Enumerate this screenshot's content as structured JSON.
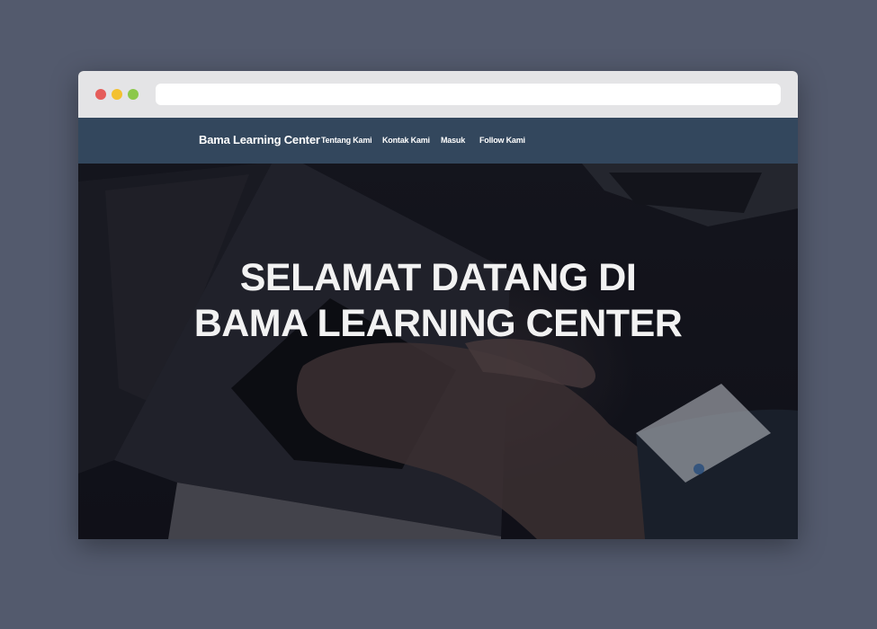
{
  "browser": {
    "controls": [
      "close",
      "minimize",
      "maximize"
    ],
    "address_value": ""
  },
  "navbar": {
    "brand": "Bama Learning Center",
    "links": [
      "Tentang Kami",
      "Kontak Kami",
      "Masuk",
      "Follow Kami"
    ],
    "background": "#33475d"
  },
  "hero": {
    "title_line1": "SELAMAT DATANG DI",
    "title_line2": "BAMA LEARNING CENTER",
    "image": "laptop-typing-photo"
  },
  "colors": {
    "page_background": "#535a6d",
    "navbar": "#33475d",
    "hero_text": "#f2f2f2"
  }
}
